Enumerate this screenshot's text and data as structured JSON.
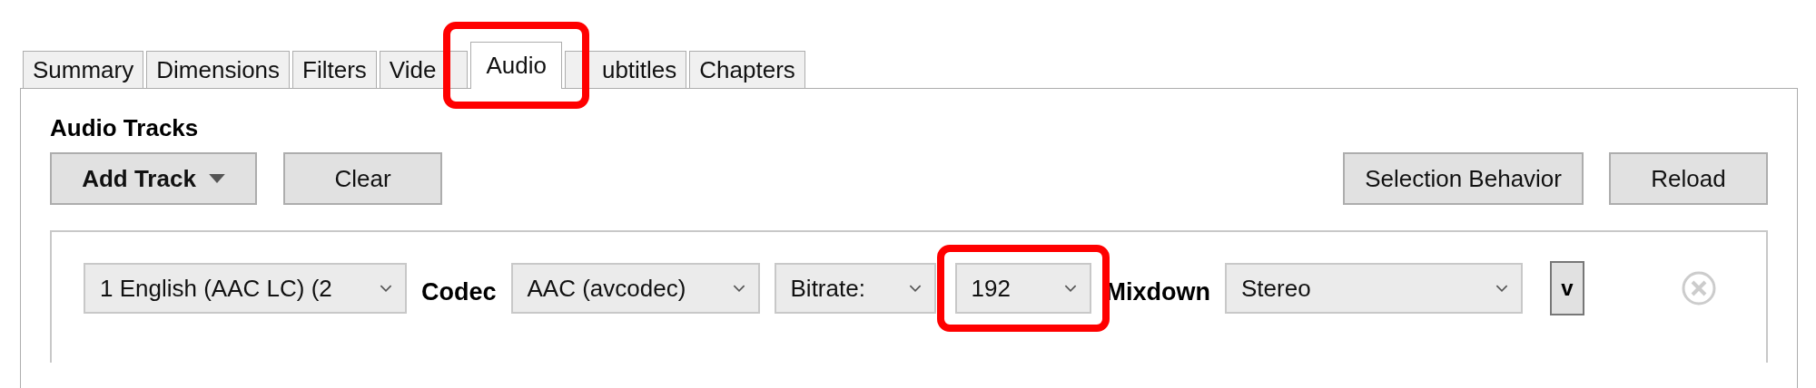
{
  "tabs": [
    {
      "label": "Summary",
      "selected": false,
      "highlighted": false
    },
    {
      "label": "Dimensions",
      "selected": false,
      "highlighted": false
    },
    {
      "label": "Filters",
      "selected": false,
      "highlighted": false
    },
    {
      "label": "Vide",
      "selected": false,
      "highlighted": false
    },
    {
      "label": "Audio",
      "selected": true,
      "highlighted": true
    },
    {
      "label": "ubtitles",
      "selected": false,
      "highlighted": false
    },
    {
      "label": "Chapters",
      "selected": false,
      "highlighted": false
    }
  ],
  "section_title": "Audio Tracks",
  "toolbar_left": [
    {
      "label": "Add Track",
      "kind": "menu"
    },
    {
      "label": "Clear",
      "kind": "plain"
    }
  ],
  "toolbar_right": [
    {
      "label": "Selection Behavior",
      "kind": "plain"
    },
    {
      "label": "Reload",
      "kind": "plain"
    }
  ],
  "track_row": [
    {
      "kind": "dropdown",
      "value": "1 English (AAC LC) (2",
      "highlighted": false
    },
    {
      "kind": "label",
      "text": "Codec"
    },
    {
      "kind": "dropdown",
      "value": "AAC (avcodec)",
      "highlighted": false
    },
    {
      "kind": "dropdown",
      "value": "Bitrate:",
      "highlighted": false
    },
    {
      "kind": "dropdown",
      "value": "192",
      "highlighted": true
    },
    {
      "kind": "label",
      "text": "Mixdown"
    },
    {
      "kind": "dropdown",
      "value": "Stereo",
      "highlighted": false
    },
    {
      "kind": "button",
      "label": "v"
    },
    {
      "kind": "remove"
    }
  ]
}
